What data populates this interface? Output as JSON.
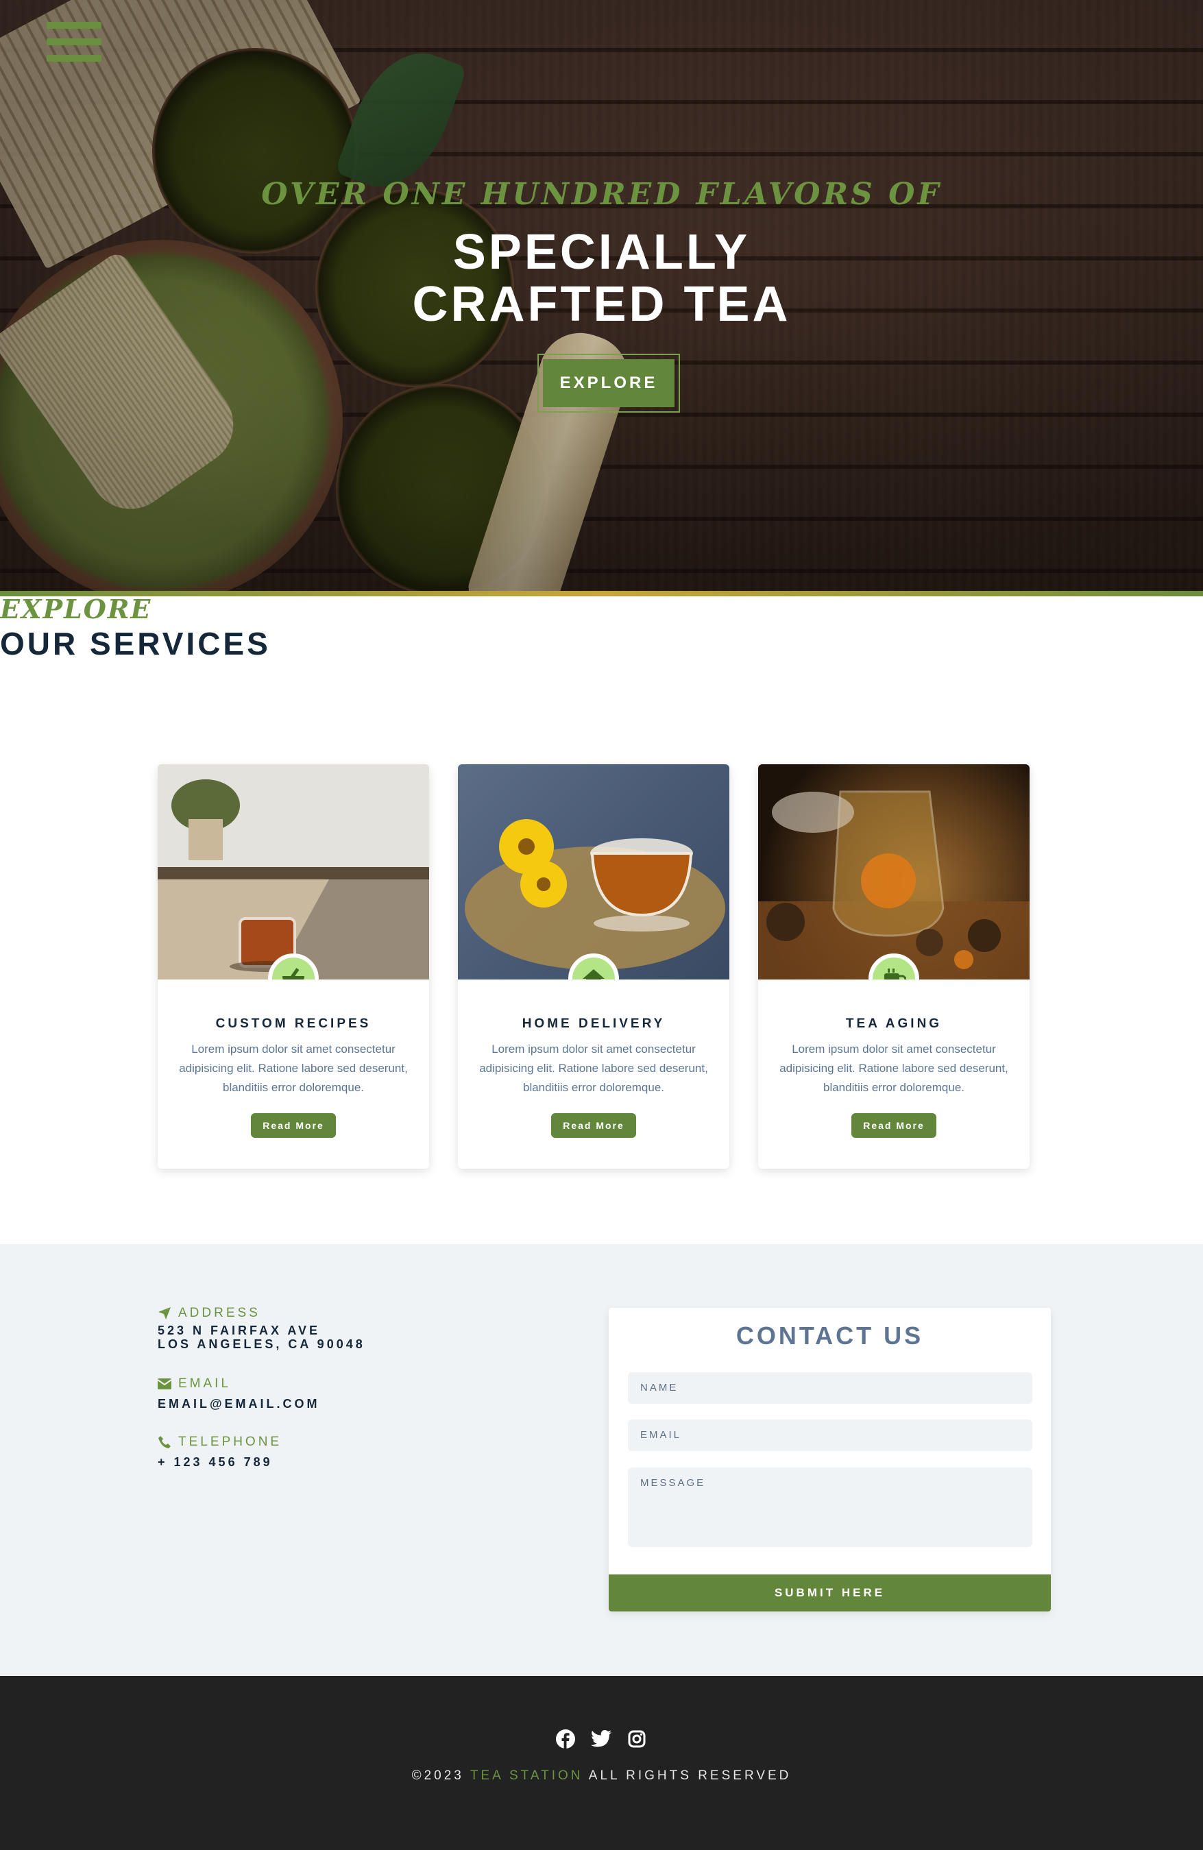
{
  "hero": {
    "subtitle": "OVER ONE HUNDRED FLAVORS OF",
    "title_line1": "SPECIALLY",
    "title_line2": "CRAFTED TEA",
    "cta": "EXPLORE",
    "menu_icon": "hamburger-menu-icon"
  },
  "services": {
    "kicker": "EXPLORE",
    "title": "OUR SERVICES",
    "cards": [
      {
        "title": "CUSTOM RECIPES",
        "text": "Lorem ipsum dolor sit amet consectetur adipisicing elit. Ratione labore sed deserunt, blanditiis error doloremque.",
        "button": "Read More",
        "icon": "mortar-pestle-icon"
      },
      {
        "title": "HOME DELIVERY",
        "text": "Lorem ipsum dolor sit amet consectetur adipisicing elit. Ratione labore sed deserunt, blanditiis error doloremque.",
        "button": "Read More",
        "icon": "home-icon"
      },
      {
        "title": "TEA AGING",
        "text": "Lorem ipsum dolor sit amet consectetur adipisicing elit. Ratione labore sed deserunt, blanditiis error doloremque.",
        "button": "Read More",
        "icon": "mug-icon"
      }
    ]
  },
  "contact": {
    "address_label": "ADDRESS",
    "address_line1": "523 N FAIRFAX AVE",
    "address_line2": "LOS ANGELES, CA 90048",
    "email_label": "EMAIL",
    "email_value": "EMAIL@EMAIL.COM",
    "phone_label": "TELEPHONE",
    "phone_value": "+ 123 456 789",
    "form_title": "CONTACT US",
    "name_placeholder": "NAME",
    "email_placeholder": "EMAIL",
    "message_placeholder": "MESSAGE",
    "submit": "SUBMIT HERE"
  },
  "footer": {
    "copy_prefix": "©2023",
    "brand": "TEA STATION",
    "copy_suffix": "ALL RIGHTS RESERVED",
    "social": [
      "facebook-icon",
      "twitter-icon",
      "instagram-icon"
    ]
  },
  "colors": {
    "accent_green": "#62873a",
    "light_green": "#b3e486",
    "navy": "#16273a",
    "footer_bg": "#222222",
    "section_bg": "#eff3f6"
  }
}
